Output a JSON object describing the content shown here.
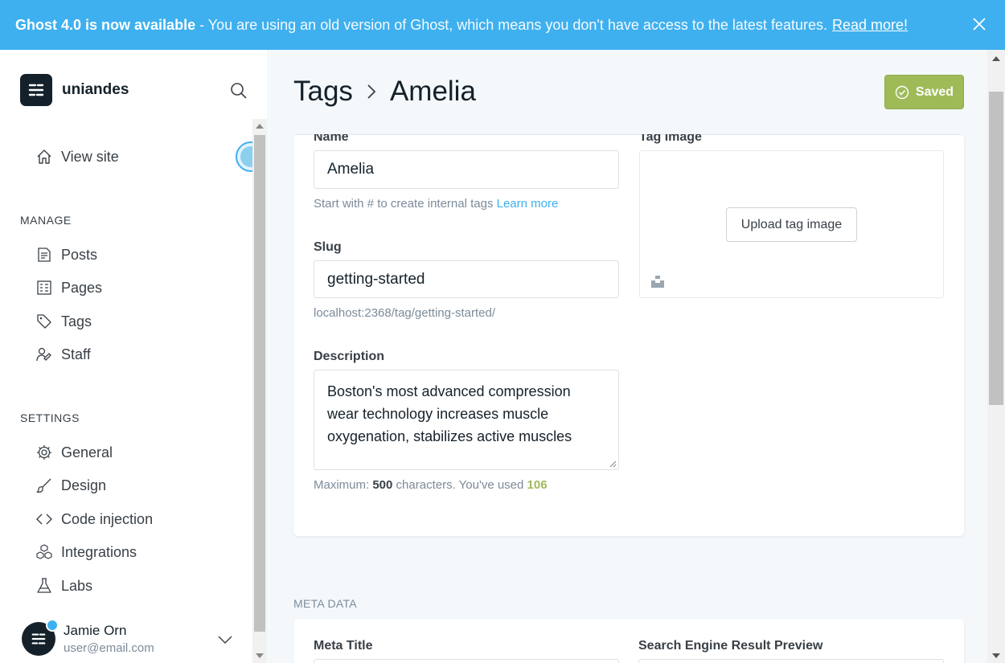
{
  "banner": {
    "title": "Ghost 4.0 is now available",
    "message": "- You are using an old version of Ghost, which means you don't have access to the latest features.",
    "link": "Read more!"
  },
  "sidebar": {
    "site_name": "uniandes",
    "view_site": "View site",
    "manage_heading": "MANAGE",
    "manage_items": [
      {
        "label": "Posts",
        "icon": "posts-icon"
      },
      {
        "label": "Pages",
        "icon": "pages-icon"
      },
      {
        "label": "Tags",
        "icon": "tag-icon"
      },
      {
        "label": "Staff",
        "icon": "staff-icon"
      }
    ],
    "settings_heading": "SETTINGS",
    "settings_items": [
      {
        "label": "General",
        "icon": "gear-icon"
      },
      {
        "label": "Design",
        "icon": "brush-icon"
      },
      {
        "label": "Code injection",
        "icon": "code-icon"
      },
      {
        "label": "Integrations",
        "icon": "integrations-icon"
      },
      {
        "label": "Labs",
        "icon": "flask-icon"
      }
    ],
    "user": {
      "name": "Jamie Orn",
      "email": "user@email.com"
    }
  },
  "header": {
    "breadcrumb_parent": "Tags",
    "breadcrumb_current": "Amelia",
    "saved_label": "Saved"
  },
  "form": {
    "name_label": "Name",
    "name_value": "Amelia",
    "name_hint": "Start with # to create internal tags",
    "name_hint_link": "Learn more",
    "slug_label": "Slug",
    "slug_value": "getting-started",
    "slug_url": "localhost:2368/tag/getting-started/",
    "description_label": "Description",
    "description_value": "Boston's most advanced compression wear technology increases muscle oxygenation, stabilizes active muscles",
    "count_prefix": "Maximum:",
    "count_max": "500",
    "count_mid": "characters. You've used",
    "count_used": "106",
    "tag_image_label": "Tag image",
    "upload_label": "Upload tag image"
  },
  "meta": {
    "heading": "META DATA",
    "meta_title_label": "Meta Title",
    "serp_label": "Search Engine Result Preview"
  },
  "colors": {
    "accent": "#3eb0ef",
    "saved": "#9fbb58",
    "dark": "#15212a"
  }
}
